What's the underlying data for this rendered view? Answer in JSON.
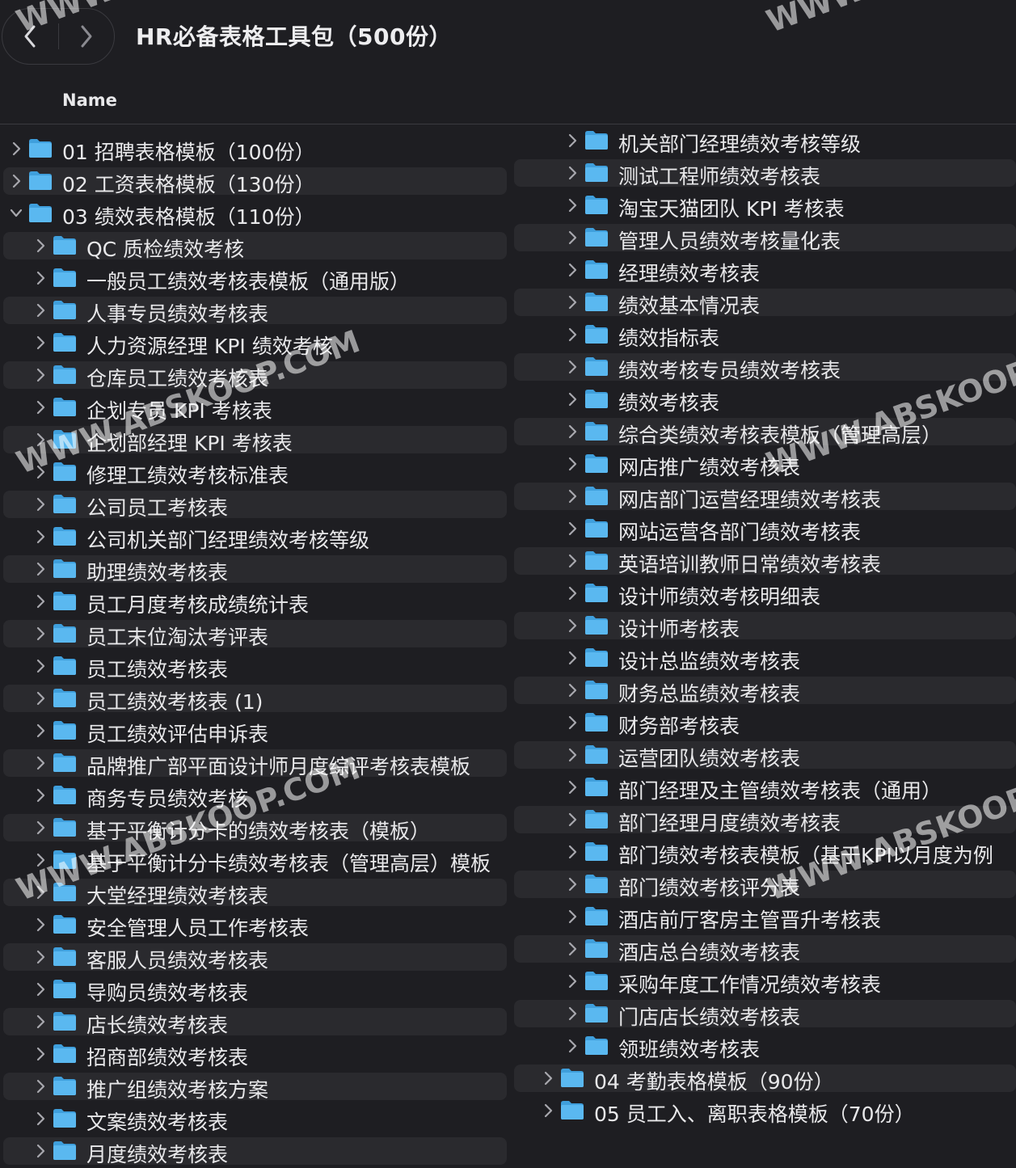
{
  "window": {
    "title": "HR必备表格工具包（500份）"
  },
  "toolbar": {
    "back_icon": "chevron-left-icon",
    "forward_icon": "chevron-right-icon"
  },
  "header": {
    "name_column": "Name"
  },
  "colors": {
    "background": "#1e1e22",
    "row_stripe": "#2a2a2e",
    "folder": "#5ab8f0",
    "text": "#e8e8ea"
  },
  "watermarks": [
    "WWW.ABSKOOP.COM",
    "WWW.ABSKOOP.COM",
    "WWW.ABSKOOP.COM",
    "WWW.ABSKOOP",
    "WWW.ABSKOOP",
    "WWW.",
    "WWW."
  ],
  "left_column": [
    {
      "label": "01 招聘表格模板（100份）",
      "level": 0,
      "expanded": false
    },
    {
      "label": "02 工资表格模板（130份）",
      "level": 0,
      "expanded": false
    },
    {
      "label": "03 绩效表格模板（110份）",
      "level": 0,
      "expanded": true
    },
    {
      "label": "QC 质检绩效考核",
      "level": 1,
      "expanded": false
    },
    {
      "label": "一般员工绩效考核表模板（通用版）",
      "level": 1,
      "expanded": false
    },
    {
      "label": "人事专员绩效考核表",
      "level": 1,
      "expanded": false
    },
    {
      "label": "人力资源经理 KPI 绩效考核",
      "level": 1,
      "expanded": false
    },
    {
      "label": "仓库员工绩效考核表",
      "level": 1,
      "expanded": false
    },
    {
      "label": "企划专员 KPI 考核表",
      "level": 1,
      "expanded": false
    },
    {
      "label": "企划部经理 KPI 考核表",
      "level": 1,
      "expanded": false
    },
    {
      "label": "修理工绩效考核标准表",
      "level": 1,
      "expanded": false
    },
    {
      "label": "公司员工考核表",
      "level": 1,
      "expanded": false
    },
    {
      "label": "公司机关部门经理绩效考核等级",
      "level": 1,
      "expanded": false
    },
    {
      "label": "助理绩效考核表",
      "level": 1,
      "expanded": false
    },
    {
      "label": "员工月度考核成绩统计表",
      "level": 1,
      "expanded": false
    },
    {
      "label": "员工末位淘汰考评表",
      "level": 1,
      "expanded": false
    },
    {
      "label": "员工绩效考核表",
      "level": 1,
      "expanded": false
    },
    {
      "label": "员工绩效考核表 (1)",
      "level": 1,
      "expanded": false
    },
    {
      "label": "员工绩效评估申诉表",
      "level": 1,
      "expanded": false
    },
    {
      "label": "品牌推广部平面设计师月度综评考核表模板",
      "level": 1,
      "expanded": false
    },
    {
      "label": "商务专员绩效考核",
      "level": 1,
      "expanded": false
    },
    {
      "label": "基于平衡计分卡的绩效考核表（模板）",
      "level": 1,
      "expanded": false
    },
    {
      "label": "基于平衡计分卡绩效考核表（管理高层）模板",
      "level": 1,
      "expanded": false
    },
    {
      "label": "大堂经理绩效考核表",
      "level": 1,
      "expanded": false
    },
    {
      "label": "安全管理人员工作考核表",
      "level": 1,
      "expanded": false
    },
    {
      "label": "客服人员绩效考核表",
      "level": 1,
      "expanded": false
    },
    {
      "label": "导购员绩效考核表",
      "level": 1,
      "expanded": false
    },
    {
      "label": "店长绩效考核表",
      "level": 1,
      "expanded": false
    },
    {
      "label": "招商部绩效考核表",
      "level": 1,
      "expanded": false
    },
    {
      "label": "推广组绩效考核方案",
      "level": 1,
      "expanded": false
    },
    {
      "label": "文案绩效考核表",
      "level": 1,
      "expanded": false
    },
    {
      "label": "月度绩效考核表",
      "level": 1,
      "expanded": false
    }
  ],
  "right_column": [
    {
      "label": "机关部门经理绩效考核等级",
      "level": 1,
      "expanded": false
    },
    {
      "label": "测试工程师绩效考核表",
      "level": 1,
      "expanded": false
    },
    {
      "label": "淘宝天猫团队 KPI 考核表",
      "level": 1,
      "expanded": false
    },
    {
      "label": "管理人员绩效考核量化表",
      "level": 1,
      "expanded": false
    },
    {
      "label": "经理绩效考核表",
      "level": 1,
      "expanded": false
    },
    {
      "label": "绩效基本情况表",
      "level": 1,
      "expanded": false
    },
    {
      "label": "绩效指标表",
      "level": 1,
      "expanded": false
    },
    {
      "label": "绩效考核专员绩效考核表",
      "level": 1,
      "expanded": false
    },
    {
      "label": "绩效考核表",
      "level": 1,
      "expanded": false
    },
    {
      "label": "综合类绩效考核表模板（管理高层）",
      "level": 1,
      "expanded": false
    },
    {
      "label": "网店推广绩效考核表",
      "level": 1,
      "expanded": false
    },
    {
      "label": "网店部门运营经理绩效考核表",
      "level": 1,
      "expanded": false
    },
    {
      "label": "网站运营各部门绩效考核表",
      "level": 1,
      "expanded": false
    },
    {
      "label": "英语培训教师日常绩效考核表",
      "level": 1,
      "expanded": false
    },
    {
      "label": "设计师绩效考核明细表",
      "level": 1,
      "expanded": false
    },
    {
      "label": "设计师考核表",
      "level": 1,
      "expanded": false
    },
    {
      "label": "设计总监绩效考核表",
      "level": 1,
      "expanded": false
    },
    {
      "label": "财务总监绩效考核表",
      "level": 1,
      "expanded": false
    },
    {
      "label": "财务部考核表",
      "level": 1,
      "expanded": false
    },
    {
      "label": "运营团队绩效考核表",
      "level": 1,
      "expanded": false
    },
    {
      "label": "部门经理及主管绩效考核表（通用）",
      "level": 1,
      "expanded": false
    },
    {
      "label": "部门经理月度绩效考核表",
      "level": 1,
      "expanded": false
    },
    {
      "label": "部门绩效考核表模板（基于KPI以月度为例",
      "level": 1,
      "expanded": false
    },
    {
      "label": "部门绩效考核评分表",
      "level": 1,
      "expanded": false
    },
    {
      "label": "酒店前厅客房主管晋升考核表",
      "level": 1,
      "expanded": false
    },
    {
      "label": "酒店总台绩效考核表",
      "level": 1,
      "expanded": false
    },
    {
      "label": "采购年度工作情况绩效考核表",
      "level": 1,
      "expanded": false
    },
    {
      "label": "门店店长绩效考核表",
      "level": 1,
      "expanded": false
    },
    {
      "label": "领班绩效考核表",
      "level": 1,
      "expanded": false
    },
    {
      "label": "04 考勤表格模板（90份）",
      "level": 0,
      "expanded": false
    },
    {
      "label": "05 员工入、离职表格模板（70份）",
      "level": 0,
      "expanded": false
    }
  ]
}
